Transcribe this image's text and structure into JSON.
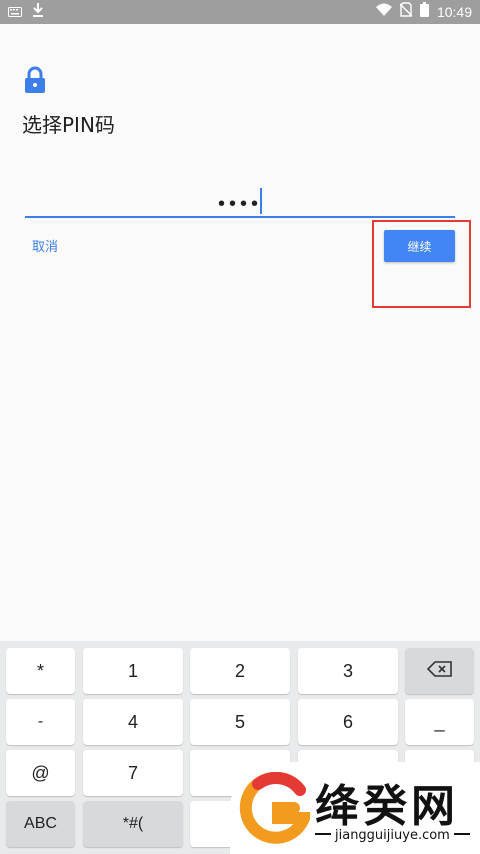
{
  "status_bar": {
    "time": "10:49",
    "icons": [
      "keyboard-icon",
      "download-icon",
      "wifi-icon",
      "no-sim-icon",
      "battery-icon"
    ]
  },
  "screen": {
    "lock_icon": "lock-icon",
    "title": "选择PIN码",
    "pin_value": "••••",
    "cancel_label": "取消",
    "continue_label": "继续",
    "accent_color": "#4285f4",
    "highlight_color": "#e53935"
  },
  "keyboard": {
    "rows": [
      [
        "*",
        "1",
        "2",
        "3",
        "backspace-icon"
      ],
      [
        "-",
        "4",
        "5",
        "6",
        "_"
      ],
      [
        "@",
        "7",
        "",
        "",
        ""
      ],
      [
        "ABC",
        "*#(",
        "",
        "",
        ""
      ]
    ],
    "keys": {
      "star": "*",
      "one": "1",
      "two": "2",
      "three": "3",
      "dash": "-",
      "four": "4",
      "five": "5",
      "six": "6",
      "underscore": "_",
      "at": "@",
      "seven": "7",
      "abc": "ABC",
      "symbols": "*#("
    }
  },
  "watermark": {
    "logo_icon": "g-logo-icon",
    "text": "绛癸网",
    "subtext": "jiangguijiuye.com"
  }
}
